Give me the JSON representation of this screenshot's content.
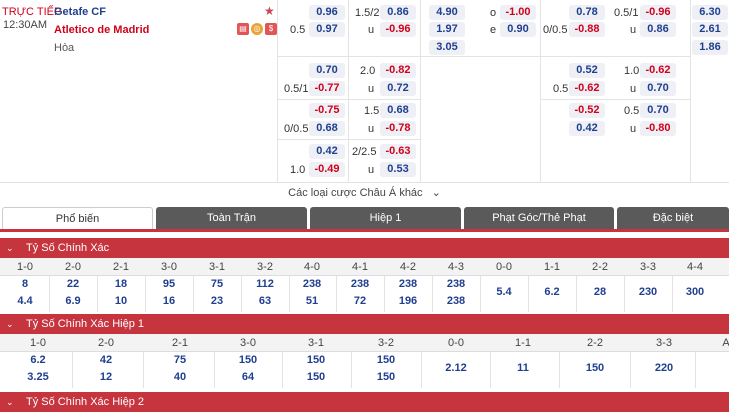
{
  "match": {
    "live_label": "TRỰC TIẾP",
    "time": "12:30AM",
    "home": "Getafe CF",
    "away": "Atletico de Madrid",
    "draw": "Hòa",
    "icons": [
      "scoreboard-icon",
      "coin-icon",
      "dollar-icon"
    ]
  },
  "ft_handicap": {
    "rows": [
      {
        "line": "",
        "home": "0.96",
        "away_line": "0.5",
        "away": "0.97"
      }
    ]
  },
  "ft": {
    "c1_home": "0.96",
    "c1_line_away": "0.5",
    "c1_away": "0.97",
    "c2_line": "1.5/2",
    "c2_over": "0.86",
    "c2_u": "u",
    "c2_under": "-0.96",
    "c3_1": "4.90",
    "c3_2": "1.97",
    "c3_3": "3.05",
    "c4_o": "o",
    "c4_o_val": "-1.00",
    "c4_e": "e",
    "c4_e_val": "0.90"
  },
  "ft_more": [
    {
      "hl": "",
      "h": "0.70",
      "al": "0.5/1",
      "a": "-0.77",
      "ol": "2.0",
      "o": "-0.82",
      "u": "u",
      "uv": "0.72"
    },
    {
      "hl": "",
      "h": "-0.75",
      "al": "0/0.5",
      "a": "0.68",
      "ol": "1.5",
      "o": "0.68",
      "u": "u",
      "uv": "-0.78"
    },
    {
      "hl": "",
      "h": "0.42",
      "al": "1.0",
      "a": "-0.49",
      "ol": "2/2.5",
      "o": "-0.63",
      "u": "u",
      "uv": "0.53"
    }
  ],
  "h1": {
    "r1": {
      "h": "0.78",
      "al": "0/0.5",
      "a": "-0.88",
      "ol": "0.5/1",
      "o": "-0.96",
      "u": "u",
      "uv": "0.86",
      "x1": "6.30",
      "x2": "2.61",
      "x3": "1.86"
    },
    "r2": {
      "h": "0.52",
      "al": "0.5",
      "a": "-0.62",
      "ol": "1.0",
      "o": "-0.62",
      "u": "u",
      "uv": "0.70"
    },
    "r3": {
      "h": "-0.52",
      "al": "",
      "a": "0.42",
      "ol": "0.5",
      "o": "0.70",
      "u": "u",
      "uv": "-0.80"
    }
  },
  "more_label": "Các loại cược Châu Á khác",
  "tabs": [
    "Phổ biến",
    "Toàn Trận",
    "Hiệp 1",
    "Phạt Góc/Thẻ Phạt",
    "Đặc biệt"
  ],
  "sections": {
    "s1": "Tỷ Số Chính Xác",
    "s2": "Tỷ Số Chính Xác Hiệp 1",
    "s3": "Tỷ Số Chính Xác Hiệp 2"
  },
  "cs_full": {
    "headers": [
      "1-0",
      "2-0",
      "2-1",
      "3-0",
      "3-1",
      "3-2",
      "4-0",
      "4-1",
      "4-2",
      "4-3",
      "0-0",
      "1-1",
      "2-2",
      "3-3",
      "4-4"
    ],
    "home_odds": [
      "8",
      "22",
      "18",
      "95",
      "75",
      "112",
      "238",
      "238",
      "238",
      "238",
      "5.4",
      "6.2",
      "28",
      "230",
      "300"
    ],
    "away_odds": [
      "4.4",
      "6.9",
      "10",
      "16",
      "23",
      "63",
      "51",
      "72",
      "196",
      "238",
      "",
      "",
      "",
      "",
      ""
    ]
  },
  "cs_h1": {
    "headers": [
      "1-0",
      "2-0",
      "2-1",
      "3-0",
      "3-1",
      "3-2",
      "0-0",
      "1-1",
      "2-2",
      "3-3",
      "A"
    ],
    "home_odds": [
      "6.2",
      "42",
      "75",
      "150",
      "150",
      "150",
      "2.12",
      "11",
      "150",
      "220",
      ""
    ],
    "away_odds": [
      "3.25",
      "12",
      "40",
      "64",
      "150",
      "150",
      "",
      "",
      "",
      "",
      ""
    ]
  }
}
